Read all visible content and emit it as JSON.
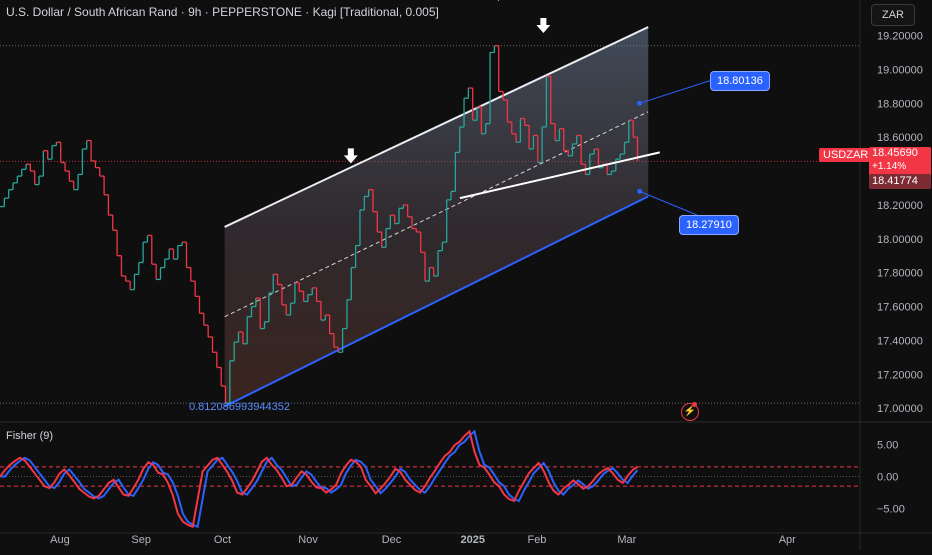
{
  "header": {
    "title": "U.S. Dollar / South African Rand · 9h · PEPPERSTONE · Kagi [Traditional, 0.005]",
    "currency": "ZAR"
  },
  "indicator": {
    "label": "Fisher (9)"
  },
  "callouts": {
    "upper": "18.80136",
    "lower": "18.27910",
    "bottom": "0.812086993944352"
  },
  "price": {
    "symbol": "USDZAR",
    "last": "18.45690",
    "change": "+1.14%",
    "second": "18.41774"
  },
  "colors": {
    "up": "#26a69a",
    "down": "#f23645",
    "channel_upper": "#e8ecf3",
    "channel_lower": "#2962ff",
    "fisher_a": "#f23645",
    "fisher_b": "#2962ff",
    "background": "#0f0f0f"
  },
  "chart_data": [
    {
      "type": "line",
      "subtype": "kagi",
      "ylim": [
        16.93,
        19.28
      ],
      "yticks": [
        "19.20000",
        "19.00000",
        "18.80000",
        "18.60000",
        "18.40000",
        "18.20000",
        "18.00000",
        "17.80000",
        "17.60000",
        "17.40000",
        "17.20000",
        "17.00000"
      ],
      "ytick_values": [
        19.2,
        19.0,
        18.8,
        18.6,
        18.4,
        18.2,
        18.0,
        17.8,
        17.6,
        17.4,
        17.2,
        17.0
      ],
      "x_ticks": [
        "Aug",
        "Sep",
        "Oct",
        "Nov",
        "Dec",
        "2025",
        "Feb",
        "Mar",
        "Apr"
      ],
      "x_tick_index": [
        14.0,
        33.0,
        52.0,
        72.0,
        91.5,
        110.5,
        125.5,
        146.5,
        184.0
      ],
      "x_range": [
        0,
        201
      ],
      "series": [
        {
          "values": [
            18.19,
            18.24,
            18.29,
            18.33,
            18.37,
            18.41,
            18.44,
            18.4,
            18.32,
            18.37,
            18.52,
            18.47,
            18.55,
            18.57,
            18.45,
            18.4,
            18.34,
            18.29,
            18.38,
            18.53,
            18.58,
            18.46,
            18.42,
            18.37,
            18.26,
            18.14,
            18.05,
            17.9,
            17.78,
            17.75,
            17.7,
            17.79,
            17.86,
            17.98,
            18.02,
            17.85,
            17.76,
            17.83,
            17.88,
            17.94,
            17.88,
            17.96,
            17.98,
            17.83,
            17.75,
            17.66,
            17.56,
            17.49,
            17.42,
            17.33,
            17.24,
            17.13,
            17.03,
            17.28,
            17.39,
            17.45,
            17.38,
            17.54,
            17.6,
            17.65,
            17.47,
            17.51,
            17.68,
            17.79,
            17.73,
            17.61,
            17.55,
            17.62,
            17.74,
            17.69,
            17.63,
            17.67,
            17.71,
            17.63,
            17.52,
            17.55,
            17.44,
            17.36,
            17.33,
            17.47,
            17.64,
            17.83,
            17.96,
            18.17,
            18.25,
            18.29,
            18.16,
            18.04,
            17.95,
            18.06,
            18.14,
            18.09,
            18.18,
            18.2,
            18.13,
            18.06,
            18.04,
            17.92,
            17.75,
            17.83,
            17.78,
            17.93,
            17.98,
            18.23,
            18.28,
            18.51,
            18.66,
            18.83,
            18.89,
            18.7,
            18.78,
            18.62,
            18.68,
            19.1,
            19.14,
            18.87,
            18.82,
            18.69,
            18.62,
            18.57,
            18.71,
            18.67,
            18.53,
            18.61,
            18.45,
            18.66,
            18.96,
            18.68,
            18.58,
            18.65,
            18.52,
            18.49,
            18.56,
            18.61,
            18.44,
            18.38,
            18.5,
            18.53,
            18.42,
            18.44,
            18.38,
            18.4,
            18.47,
            18.5,
            18.57,
            18.7,
            18.6,
            18.46
          ],
          "x_start": 0,
          "x_end": 149
        }
      ]
    },
    {
      "type": "line",
      "name": "Fisher (9)",
      "ylim": [
        -8,
        8
      ],
      "yticks": [
        "5.00",
        "0.00",
        "−5.00"
      ],
      "ytick_values": [
        5,
        0,
        -5
      ],
      "hlines": [
        1.5,
        -1.5
      ],
      "series": [
        {
          "values": [
            0.0,
            1.0,
            1.8,
            2.4,
            2.9,
            2.5,
            1.5,
            0.5,
            -0.5,
            -1.5,
            -1.8,
            -0.9,
            0.4,
            1.1,
            0.2,
            -0.8,
            -1.9,
            -2.5,
            -3.1,
            -3.4,
            -3.0,
            -2.0,
            -1.0,
            -0.5,
            -1.7,
            -2.8,
            -3.0,
            -1.8,
            -0.5,
            1.2,
            2.2,
            1.8,
            0.6,
            0.3,
            -1.0,
            -3.0,
            -5.8,
            -7.0,
            -7.5,
            -7.8,
            -3.5,
            0.8,
            1.7,
            2.6,
            2.9,
            1.8,
            0.7,
            -0.7,
            -2.5,
            -2.8,
            -1.8,
            -0.7,
            0.8,
            2.3,
            2.9,
            1.8,
            1.0,
            -0.2,
            -1.5,
            -1.3,
            -0.2,
            0.8,
            0.3,
            -0.8,
            -1.7,
            -1.8,
            -2.5,
            -2.0,
            -1.3,
            0.5,
            1.7,
            2.6,
            2.3,
            1.5,
            -0.5,
            -1.5,
            -2.6,
            -1.9,
            -1.0,
            0.0,
            1.2,
            0.7,
            -0.5,
            -1.3,
            -2.1,
            -2.5,
            -1.5,
            -0.2,
            0.9,
            2.1,
            3.2,
            3.8,
            4.9,
            5.4,
            6.3,
            7.0,
            3.9,
            1.8,
            1.4,
            0.3,
            -0.9,
            -1.5,
            -2.8,
            -3.5,
            -3.8,
            -2.2,
            -0.9,
            0.5,
            1.3,
            2.1,
            0.9,
            -0.9,
            -2.2,
            -2.8,
            -1.9,
            -1.3,
            -0.6,
            -1.2,
            -1.9,
            -1.5,
            -0.7,
            0.3,
            0.9,
            1.3,
            0.5,
            -0.5,
            -1.0,
            0.1,
            1.0,
            1.5
          ],
          "x_start": 0,
          "x_end": 149
        }
      ]
    }
  ]
}
